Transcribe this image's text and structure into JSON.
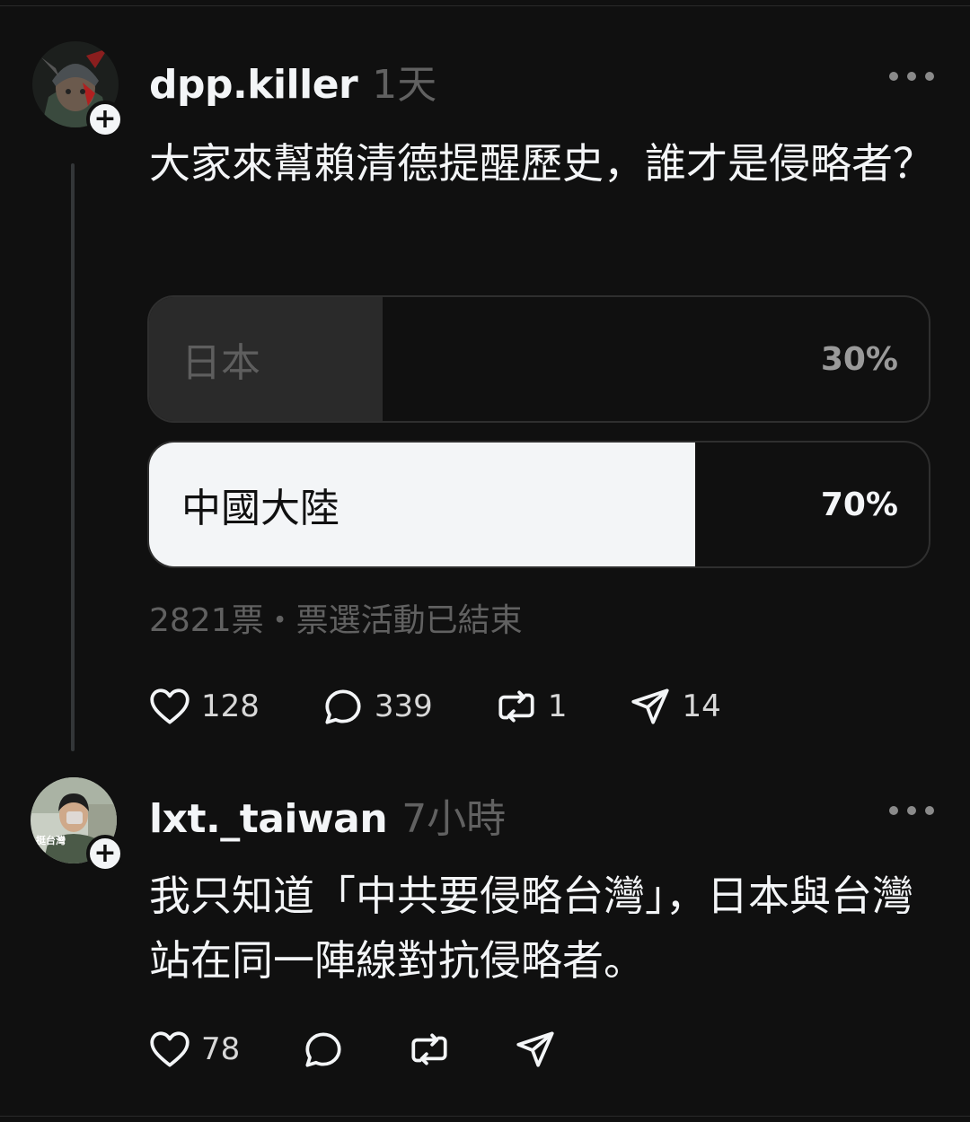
{
  "posts": [
    {
      "username": "dpp.killer",
      "time": "1天",
      "text": "大家來幫賴清德提醒歷史，誰才是侵略者？",
      "poll": {
        "options": [
          {
            "label": "日本",
            "percent_text": "30%",
            "fraction": 0.3
          },
          {
            "label": "中國大陸",
            "percent_text": "70%",
            "fraction": 0.7
          }
        ],
        "meta": "2821票・票選活動已結束"
      },
      "actions": {
        "likes": "128",
        "comments": "339",
        "reposts": "1",
        "shares": "14"
      }
    },
    {
      "username": "lxt._taiwan",
      "time": "7小時",
      "avatar_caption": "挺台灣",
      "text": "我只知道「中共要侵略台灣」，日本與台灣站在同一陣線對抗侵略者。",
      "actions": {
        "likes": "78"
      }
    }
  ],
  "follow_symbol": "+",
  "colors": {
    "background": "#101010",
    "text": "#f3f5f7",
    "muted": "#616161",
    "poll_loser_fill": "#2a2a2a",
    "poll_winner_fill": "#f3f5f7"
  },
  "icons": [
    "more-icon",
    "heart-icon",
    "comment-icon",
    "repost-icon",
    "share-icon"
  ]
}
